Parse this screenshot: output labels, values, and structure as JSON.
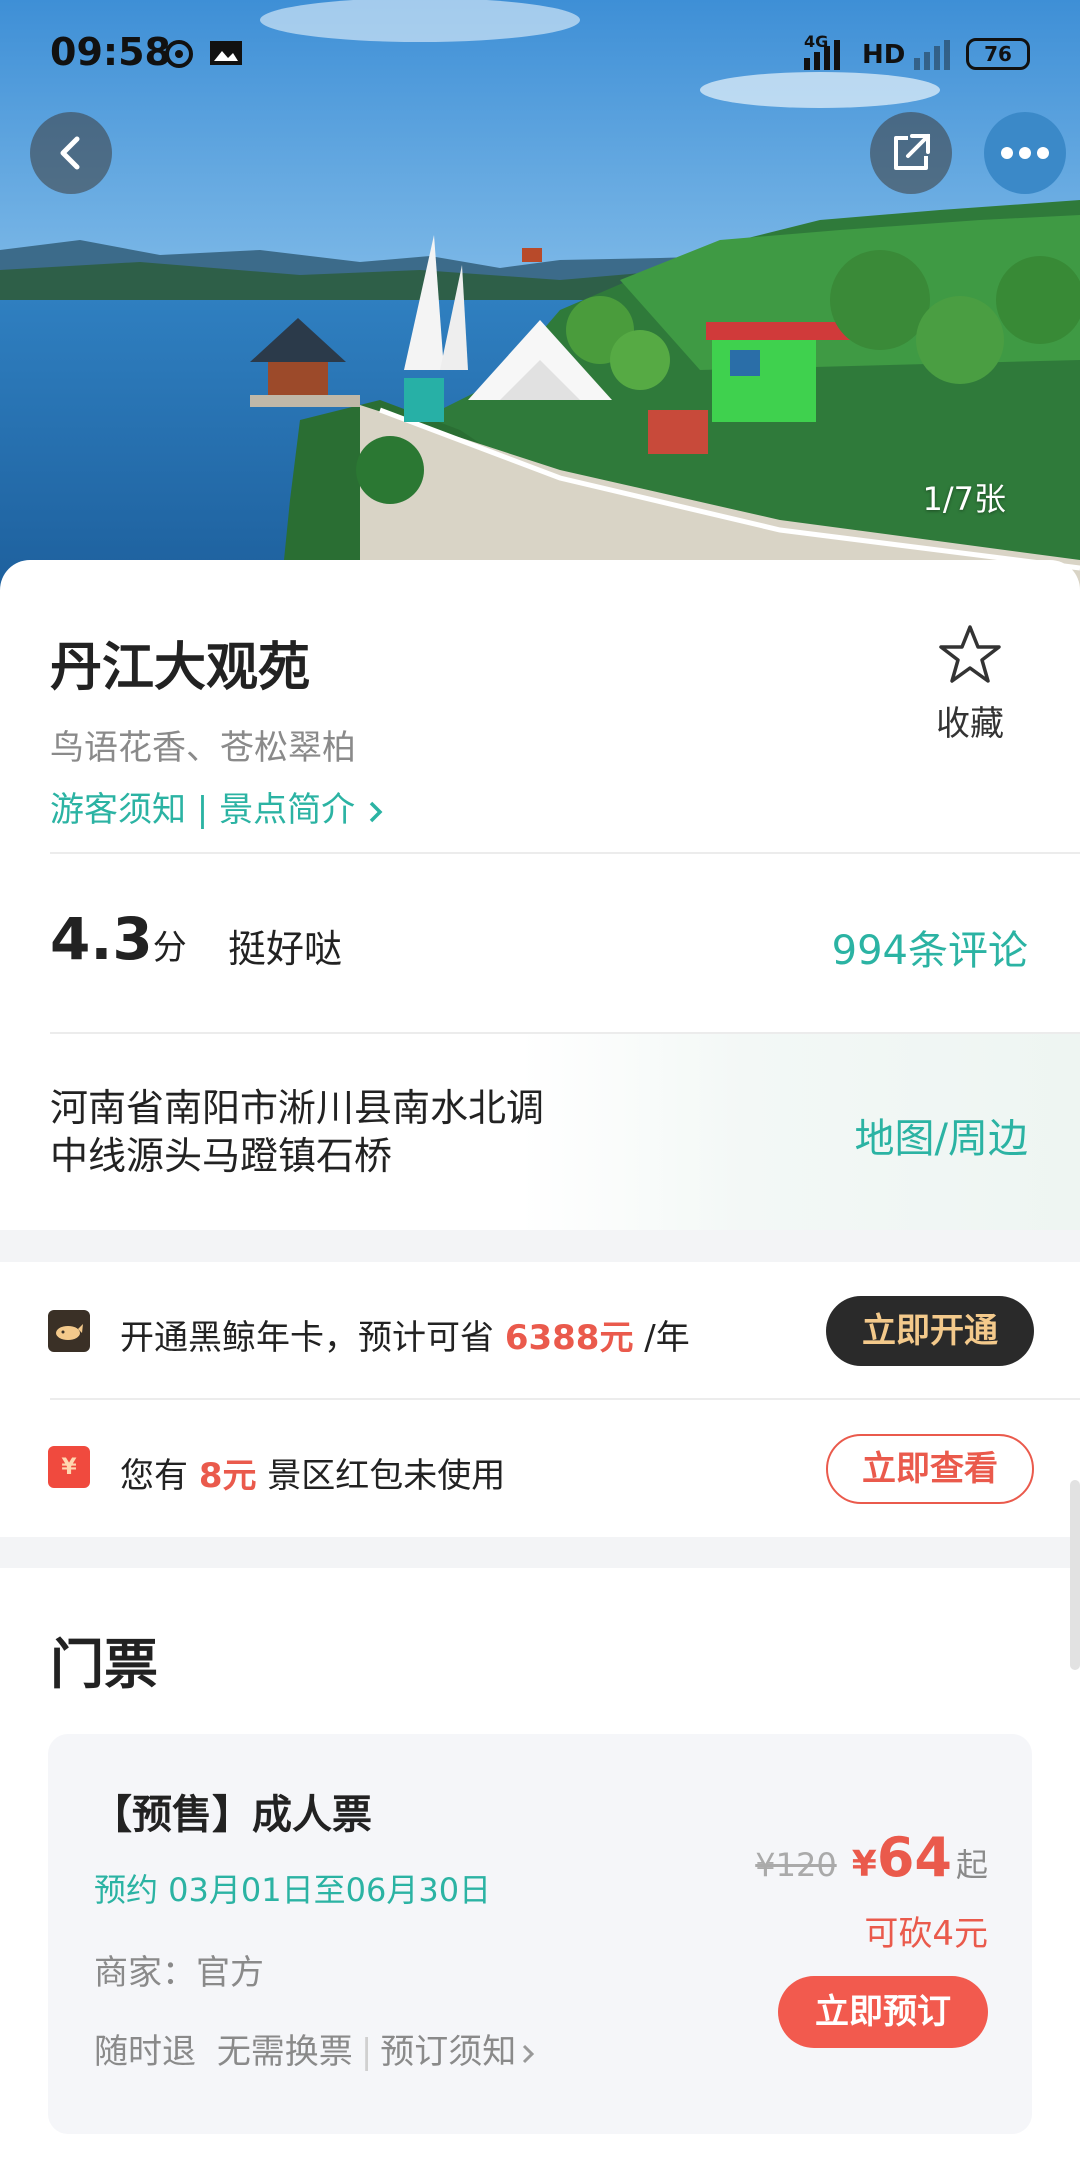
{
  "status_bar": {
    "time": "09:58",
    "battery": "76",
    "network": "4G",
    "hd": "HD"
  },
  "hero": {
    "photo_count": "1/7张",
    "icons": [
      "back-icon",
      "share-icon",
      "more-icon"
    ]
  },
  "attraction": {
    "title": "丹江大观苑",
    "subtitle": "鸟语花香、苍松翠柏",
    "links": "游客须知 | 景点简介",
    "favorite_label": "收藏",
    "score": "4.3",
    "score_unit": "分",
    "score_text": "挺好哒",
    "reviews": "994条评论",
    "address_line1": "河南省南阳市淅川县南水北调",
    "address_line2": "中线源头马蹬镇石桥",
    "map_link": "地图/周边"
  },
  "promos": {
    "card_prefix": "开通黑鲸年卡，预计可省",
    "card_amount": "6388元",
    "card_suffix": "/年",
    "card_button": "立即开通",
    "coupon_prefix": "您有",
    "coupon_amount": "8元",
    "coupon_suffix": "景区红包未使用",
    "coupon_button": "立即查看",
    "coupon_icon_text": "¥"
  },
  "tickets": {
    "section_title": "门票",
    "items": [
      {
        "name": "【预售】成人票",
        "date": "预约 03月01日至06月30日",
        "merchant": "商家：官方",
        "tag1": "随时退",
        "tag2": "无需换票",
        "tag3": "预订须知",
        "original_price": "¥120",
        "currency": "¥",
        "price": "64",
        "price_suffix": "起",
        "bargain": "可砍4元",
        "book_button": "立即预订"
      }
    ]
  },
  "colors": {
    "accent_teal": "#2bb3a3",
    "accent_red": "#ea5a4c",
    "dark_button": "#2a2a2a",
    "gold_text": "#f3c98b"
  }
}
